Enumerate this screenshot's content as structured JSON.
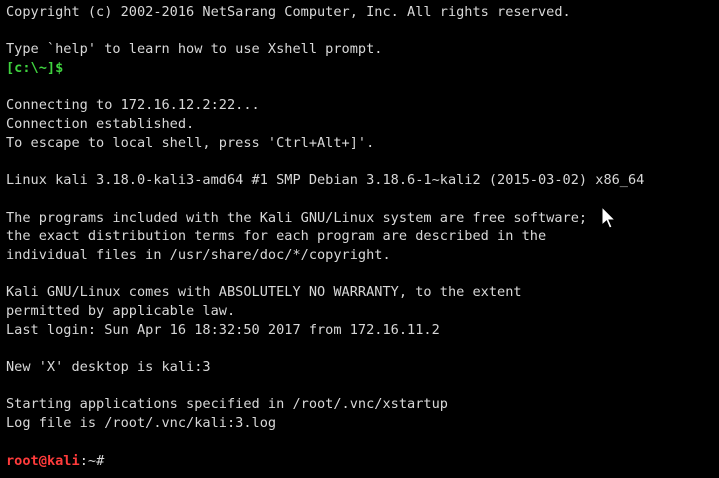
{
  "terminal": {
    "lines": {
      "copyright": "Copyright (c) 2002-2016 NetSarang Computer, Inc. All rights reserved.",
      "blank1": "",
      "help": "Type `help' to learn how to use Xshell prompt.",
      "local_prompt": "[c:\\~]$",
      "blank2": "",
      "connecting": "Connecting to 172.16.12.2:22...",
      "established": "Connection established.",
      "escape": "To escape to local shell, press 'Ctrl+Alt+]'.",
      "blank3": "",
      "uname": "Linux kali 3.18.0-kali3-amd64 #1 SMP Debian 3.18.6-1~kali2 (2015-03-02) x86_64",
      "blank4": "",
      "motd1": "The programs included with the Kali GNU/Linux system are free software;",
      "motd2": "the exact distribution terms for each program are described in the",
      "motd3": "individual files in /usr/share/doc/*/copyright.",
      "blank5": "",
      "warranty1": "Kali GNU/Linux comes with ABSOLUTELY NO WARRANTY, to the extent",
      "warranty2": "permitted by applicable law.",
      "lastlogin": "Last login: Sun Apr 16 18:32:50 2017 from 172.16.11.2",
      "blank6": "",
      "xdesktop": "New 'X' desktop is kali:3",
      "blank7": "",
      "starting": "Starting applications specified in /root/.vnc/xstartup",
      "logfile": "Log file is /root/.vnc/kali:3.log",
      "blank8": ""
    },
    "remote_prompt": {
      "user": "root",
      "at": "@",
      "host": "kali",
      "sep": ":",
      "path": "~",
      "symbol": "#"
    }
  },
  "icons": {
    "pointer": "mouse-pointer-icon"
  },
  "colors": {
    "background": "#000000",
    "text": "#d8d8d8",
    "local_prompt": "#3fd33f",
    "remote_prompt": "#ff3b3b"
  }
}
